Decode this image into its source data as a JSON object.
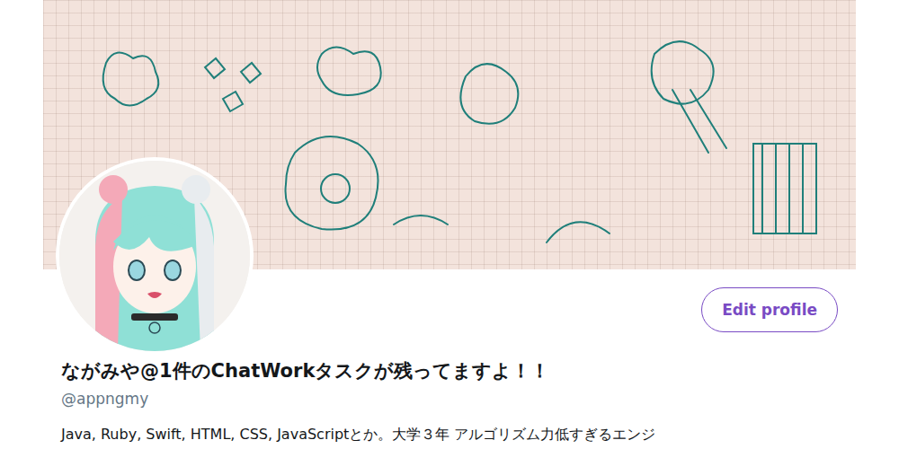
{
  "profile": {
    "name": "ながみや@1件のChatWorkタスクが残ってますよ！！",
    "handle": "@appngmy",
    "bio": "Java, Ruby, Swift, HTML, CSS, JavaScriptとか。大学３年 アルゴリズム力低すぎるエンジ"
  },
  "edit_button": {
    "label": "Edit profile"
  }
}
